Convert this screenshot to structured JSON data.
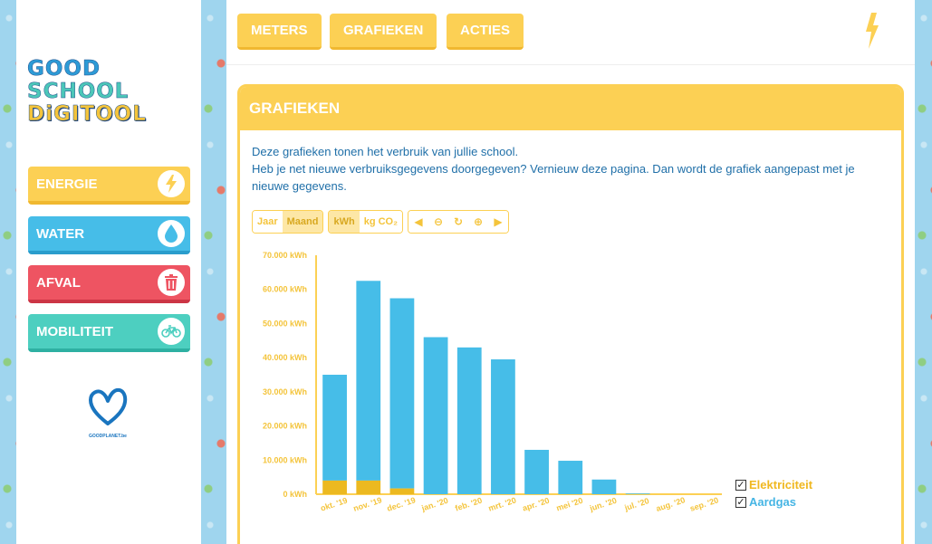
{
  "logo": {
    "line1": "GOOD",
    "line2": "SCHOOL",
    "line3": "DiGITOOL"
  },
  "sidebar": {
    "items": [
      {
        "label": "ENERGIE",
        "icon": "lightning-icon"
      },
      {
        "label": "WATER",
        "icon": "water-drop-icon"
      },
      {
        "label": "AFVAL",
        "icon": "trash-icon"
      },
      {
        "label": "MOBILITEIT",
        "icon": "bicycle-icon"
      }
    ],
    "partner": "GOODPLANET.be"
  },
  "tabs": [
    "METERS",
    "GRAFIEKEN",
    "ACTIES"
  ],
  "panel": {
    "title": "GRAFIEKEN",
    "intro_line1": "Deze grafieken tonen het verbruik van jullie school.",
    "intro_line2": "Heb je net nieuwe verbruiksgegevens doorgegeven? Vernieuw deze pagina. Dan wordt de grafiek aangepast met je nieuwe gegevens."
  },
  "controls": {
    "period": [
      "Jaar",
      "Maand"
    ],
    "period_selected": "Maand",
    "unit": [
      "kWh",
      "kg CO₂"
    ],
    "unit_selected": "kWh"
  },
  "colors": {
    "accent": "#fcd054",
    "elektriciteit": "#ecb920",
    "aardgas": "#46bde8"
  },
  "chart_data": {
    "type": "bar",
    "stacked": true,
    "categories": [
      "okt. '19",
      "nov. '19",
      "dec. '19",
      "jan. '20",
      "feb. '20",
      "mrt. '20",
      "apr. '20",
      "mei '20",
      "jun. '20",
      "jul. '20",
      "aug. '20",
      "sep. '20"
    ],
    "series": [
      {
        "name": "Elektriciteit",
        "values": [
          4000,
          4000,
          1700,
          0,
          0,
          0,
          0,
          0,
          0,
          0,
          0,
          0
        ]
      },
      {
        "name": "Aardgas",
        "values": [
          31000,
          58500,
          55700,
          46000,
          43000,
          39500,
          13000,
          9800,
          4300,
          200,
          0,
          0
        ]
      }
    ],
    "ylim": [
      0,
      70000
    ],
    "yticks": [
      "0 kWh",
      "10.000 kWh",
      "20.000 kWh",
      "30.000 kWh",
      "40.000 kWh",
      "50.000 kWh",
      "60.000 kWh",
      "70.000 kWh"
    ],
    "ytick_values": [
      0,
      10000,
      20000,
      30000,
      40000,
      50000,
      60000,
      70000
    ],
    "legend_position": "bottom-right"
  }
}
